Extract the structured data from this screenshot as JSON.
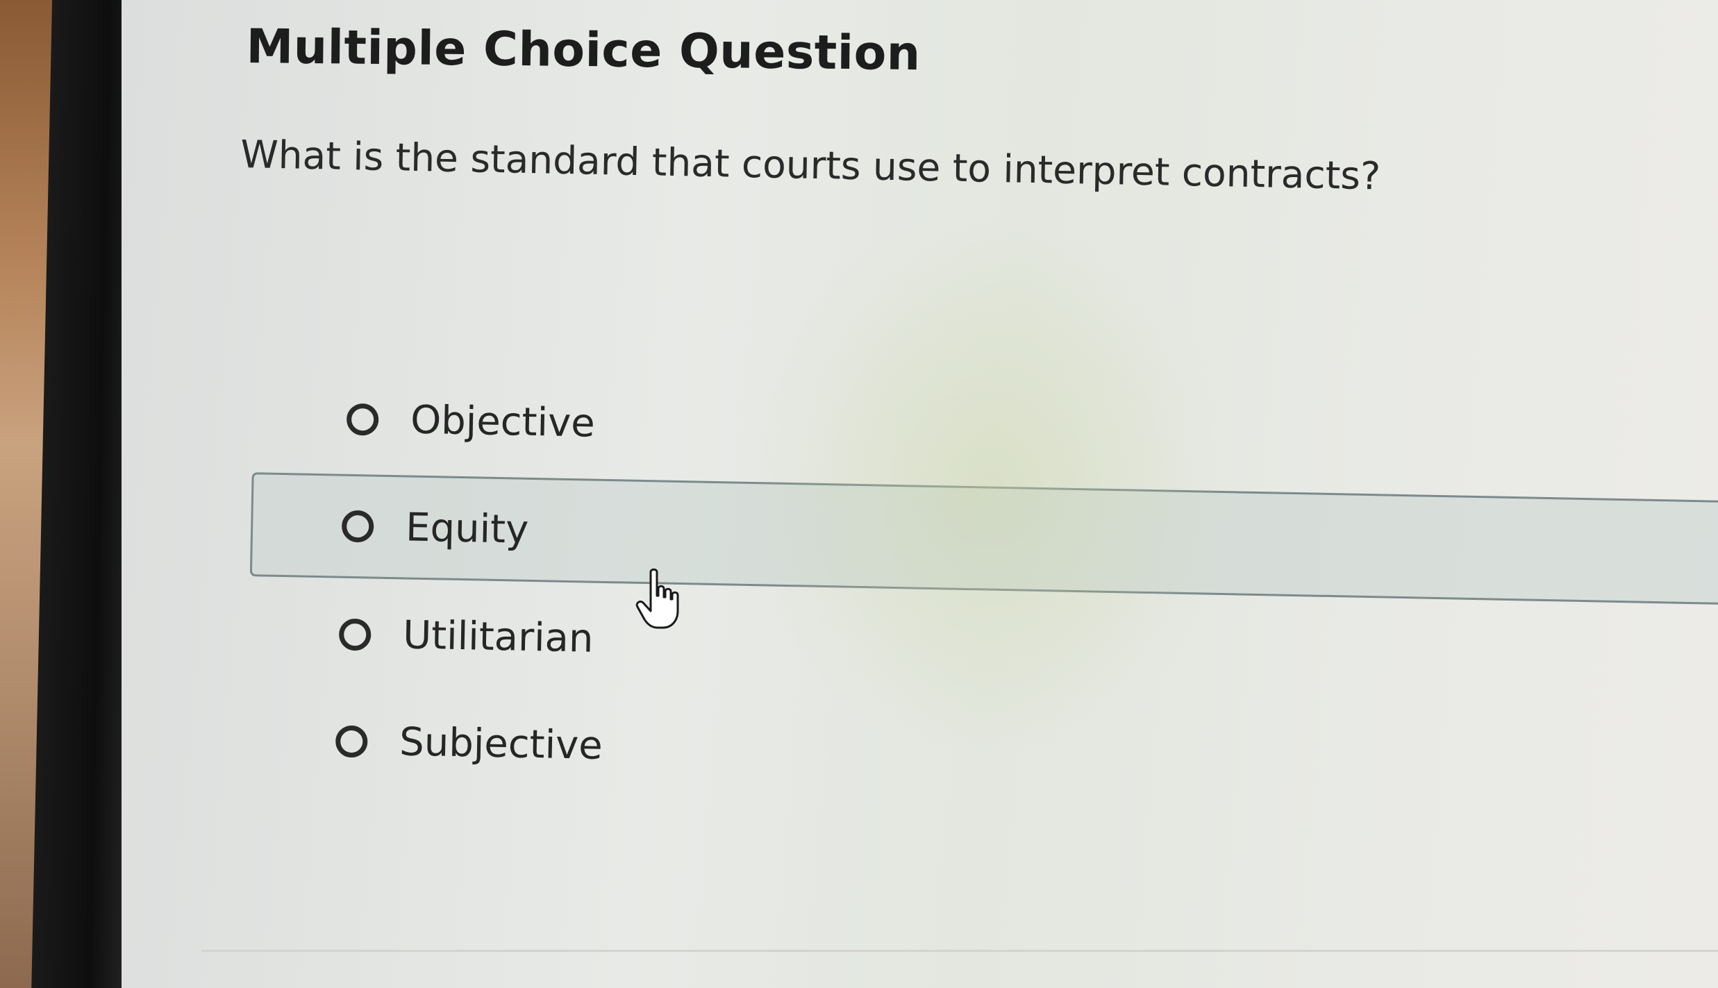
{
  "page": {
    "title": "Multiple Choice Question",
    "question": "What is the standard that courts use to interpret contracts?"
  },
  "options": [
    {
      "label": "Objective",
      "selected": false,
      "hovered": false
    },
    {
      "label": "Equity",
      "selected": false,
      "hovered": true
    },
    {
      "label": "Utilitarian",
      "selected": false,
      "hovered": false
    },
    {
      "label": "Subjective",
      "selected": false,
      "hovered": false
    }
  ],
  "cursor": {
    "icon": "hand-pointer-icon"
  },
  "colors": {
    "text": "#262626",
    "highlight_border": "#7c8a8c",
    "highlight_fill": "#c8d4d0"
  }
}
